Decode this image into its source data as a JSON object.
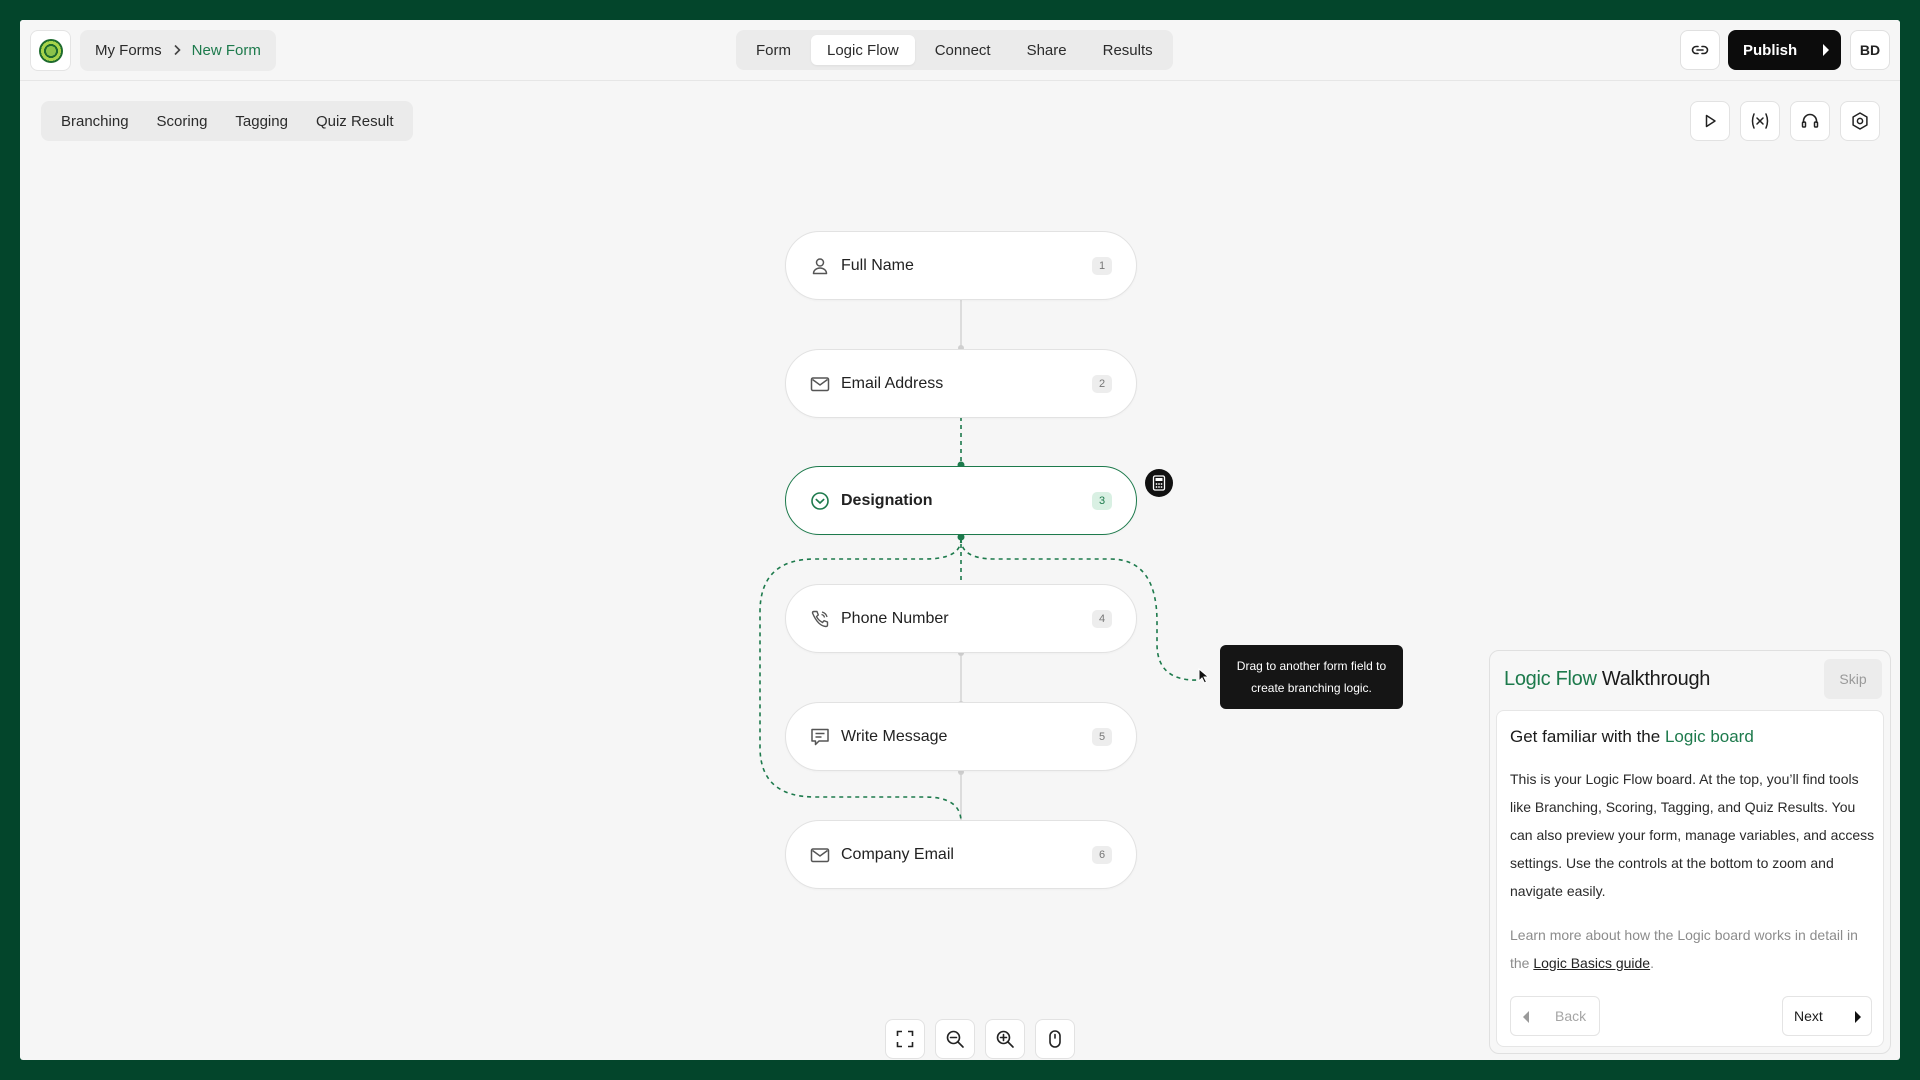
{
  "colors": {
    "frame": "#03452b",
    "accent": "#1d7a4c",
    "publish_bg": "#0c0c0c"
  },
  "breadcrumb": {
    "root": "My Forms",
    "current": "New Form"
  },
  "nav_tabs": [
    "Form",
    "Logic Flow",
    "Connect",
    "Share",
    "Results"
  ],
  "nav_active": "Logic Flow",
  "header": {
    "publish_label": "Publish",
    "avatar_initials": "BD"
  },
  "sub_tabs": [
    "Branching",
    "Scoring",
    "Tagging",
    "Quiz Result"
  ],
  "toolbar_icons": [
    "play-icon",
    "variables-icon",
    "headset-icon",
    "settings-icon"
  ],
  "nodes": [
    {
      "label": "Full Name",
      "num": "1",
      "icon": "person-icon"
    },
    {
      "label": "Email Address",
      "num": "2",
      "icon": "mail-icon"
    },
    {
      "label": "Designation",
      "num": "3",
      "icon": "dropdown-check-icon",
      "selected": true
    },
    {
      "label": "Phone Number",
      "num": "4",
      "icon": "phone-icon"
    },
    {
      "label": "Write Message",
      "num": "5",
      "icon": "message-icon"
    },
    {
      "label": "Company Email",
      "num": "6",
      "icon": "mail-icon"
    }
  ],
  "tooltip": "Drag to another form field to create branching logic.",
  "zoom_icons": [
    "fit-screen-icon",
    "zoom-out-icon",
    "zoom-in-icon",
    "mouse-icon"
  ],
  "walkthrough": {
    "title_accent": "Logic Flow",
    "title_rest": " Walkthrough",
    "skip_label": "Skip",
    "heading_prefix": "Get familiar with the ",
    "heading_accent": "Logic board",
    "body": "This is your Logic Flow board. At the top, you’ll find tools like Branching, Scoring, Tagging, and Quiz Results. You can also preview your form, manage variables, and access settings. Use the controls at the bottom to zoom and navigate easily.",
    "more_prefix": "Learn more about how the Logic board works in detail in the ",
    "more_link": "Logic Basics guide",
    "more_suffix": ".",
    "back_label": "Back",
    "next_label": "Next"
  }
}
